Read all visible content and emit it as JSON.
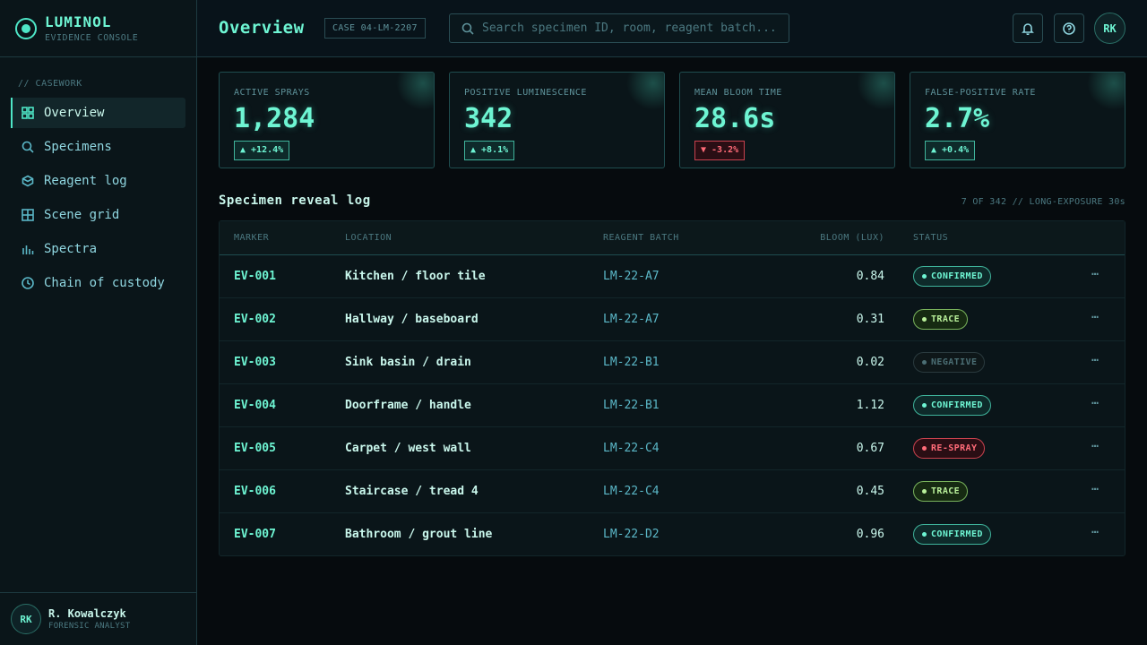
{
  "brand": {
    "name": "LUMINOL",
    "subtitle": "EVIDENCE CONSOLE"
  },
  "sidebar": {
    "section": "// CASEWORK",
    "items": [
      {
        "label": "Overview",
        "icon": "grid-icon",
        "active": true
      },
      {
        "label": "Specimens",
        "icon": "search-icon"
      },
      {
        "label": "Reagent log",
        "icon": "flask-icon"
      },
      {
        "label": "Scene grid",
        "icon": "scene-grid-icon"
      },
      {
        "label": "Spectra",
        "icon": "bar-chart-icon"
      },
      {
        "label": "Chain of custody",
        "icon": "clock-icon"
      }
    ]
  },
  "user": {
    "initials": "RK",
    "name": "R. Kowalczyk",
    "role": "FORENSIC ANALYST"
  },
  "header": {
    "title": "Overview",
    "case_id": "CASE 04-LM-2207",
    "search_placeholder": "Search specimen ID, room, reagent batch...",
    "avatar_initials": "RK"
  },
  "kpis": [
    {
      "label": "ACTIVE SPRAYS",
      "value": "1,284",
      "delta": "▲ +12.4%",
      "direction": "up"
    },
    {
      "label": "POSITIVE LUMINESCENCE",
      "value": "342",
      "delta": "▲ +8.1%",
      "direction": "up"
    },
    {
      "label": "MEAN BLOOM TIME",
      "value": "28.6s",
      "delta": "▼ -3.2%",
      "direction": "down"
    },
    {
      "label": "FALSE-POSITIVE RATE",
      "value": "2.7%",
      "delta": "▲ +0.4%",
      "direction": "up"
    }
  ],
  "table": {
    "title": "Specimen reveal log",
    "meta": "7 OF 342 // LONG-EXPOSURE 30s",
    "columns": [
      "MARKER",
      "LOCATION",
      "REAGENT BATCH",
      "BLOOM (LUX)",
      "STATUS"
    ],
    "more_icon": "⋯",
    "rows": [
      {
        "marker": "EV-001",
        "location": "Kitchen / floor tile",
        "batch": "LM-22-A7",
        "bloom": "0.84",
        "status": "CONFIRMED",
        "kind": "confirmed"
      },
      {
        "marker": "EV-002",
        "location": "Hallway / baseboard",
        "batch": "LM-22-A7",
        "bloom": "0.31",
        "status": "TRACE",
        "kind": "trace"
      },
      {
        "marker": "EV-003",
        "location": "Sink basin / drain",
        "batch": "LM-22-B1",
        "bloom": "0.02",
        "status": "NEGATIVE",
        "kind": "negative"
      },
      {
        "marker": "EV-004",
        "location": "Doorframe / handle",
        "batch": "LM-22-B1",
        "bloom": "1.12",
        "status": "CONFIRMED",
        "kind": "confirmed"
      },
      {
        "marker": "EV-005",
        "location": "Carpet / west wall",
        "batch": "LM-22-C4",
        "bloom": "0.67",
        "status": "RE-SPRAY",
        "kind": "respray"
      },
      {
        "marker": "EV-006",
        "location": "Staircase / tread 4",
        "batch": "LM-22-C4",
        "bloom": "0.45",
        "status": "TRACE",
        "kind": "trace"
      },
      {
        "marker": "EV-007",
        "location": "Bathroom / grout line",
        "batch": "LM-22-D2",
        "bloom": "0.96",
        "status": "CONFIRMED",
        "kind": "confirmed"
      }
    ]
  },
  "colors": {
    "accent": "#6ef5d3",
    "trace": "#b9f09a",
    "alert": "#ff6b78",
    "background": "#060b0e"
  }
}
